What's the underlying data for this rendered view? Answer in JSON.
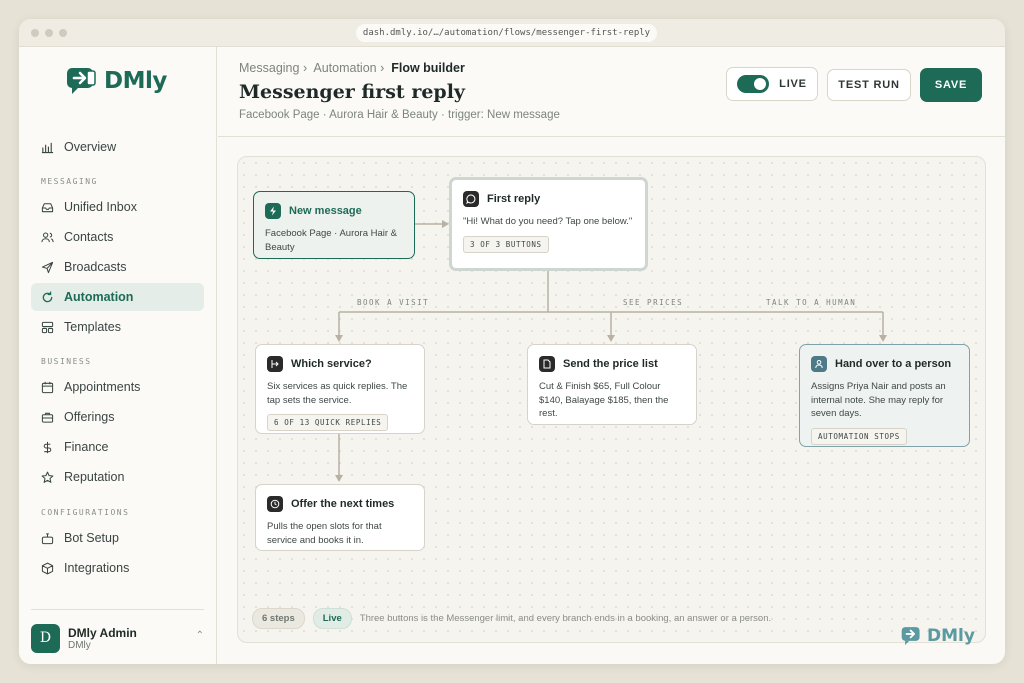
{
  "browser": {
    "url": "dash.dmly.io/…/automation/flows/messenger-first-reply"
  },
  "brand": {
    "name": "DMly",
    "accent": "#1d6b57"
  },
  "sidebar": {
    "overview": "Overview",
    "sections": {
      "messaging": "MESSAGING",
      "business": "BUSINESS",
      "configurations": "CONFIGURATIONS"
    },
    "items": {
      "inbox": "Unified Inbox",
      "contacts": "Contacts",
      "broadcasts": "Broadcasts",
      "automation": "Automation",
      "templates": "Templates",
      "appointments": "Appointments",
      "offerings": "Offerings",
      "finance": "Finance",
      "reputation": "Reputation",
      "bot_setup": "Bot Setup",
      "integrations": "Integrations"
    },
    "user": {
      "initial": "D",
      "name": "DMly Admin",
      "org": "DMly"
    }
  },
  "header": {
    "breadcrumb": {
      "first": "Messaging",
      "second": "Automation",
      "current": "Flow builder",
      "sep": "›"
    },
    "title": "Messenger first reply",
    "subtitle": "Facebook Page · Aurora Hair & Beauty · trigger: New message",
    "live_label": "LIVE",
    "live_on": true,
    "test_label": "TEST RUN",
    "save_label": "SAVE"
  },
  "flow": {
    "trigger": {
      "title": "New message",
      "body": "Facebook Page · Aurora Hair & Beauty"
    },
    "first_reply": {
      "title": "First reply",
      "body": "\"Hi! What do you need? Tap one below.\"",
      "chip": "3 OF 3 BUTTONS"
    },
    "branches": {
      "book": "BOOK A VISIT",
      "prices": "SEE PRICES",
      "human": "TALK TO A HUMAN"
    },
    "which_service": {
      "title": "Which service?",
      "body": "Six services as quick replies. The tap sets the service.",
      "chip": "6 OF 13 QUICK REPLIES"
    },
    "price_list": {
      "title": "Send the price list",
      "body": "Cut & Finish $65, Full Colour $140, Balayage $185, then the rest."
    },
    "hand_over": {
      "title": "Hand over to a person",
      "body": "Assigns Priya Nair and posts an internal note. She may reply for seven days.",
      "chip": "AUTOMATION STOPS"
    },
    "next_times": {
      "title": "Offer the next times",
      "body": "Pulls the open slots for that service and books it in."
    }
  },
  "footer": {
    "steps": "6 steps",
    "status": "Live",
    "note": "Three buttons is the Messenger limit, and every branch ends in a booking, an answer or a person."
  }
}
